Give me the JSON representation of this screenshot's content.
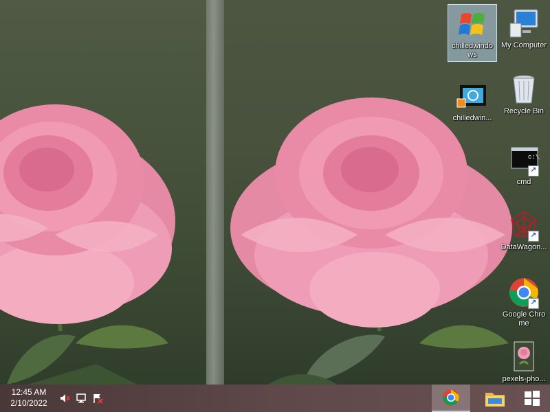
{
  "desktop": {
    "icons": [
      {
        "id": "my-computer",
        "label": "My Computer",
        "icon": "computer-icon"
      },
      {
        "id": "chilledwindows",
        "label": "chilledwindo ws",
        "icon": "windows-logo-icon",
        "selected": true
      },
      {
        "id": "recycle-bin",
        "label": "Recycle Bin",
        "icon": "recycle-bin-icon"
      },
      {
        "id": "chilledwin-video",
        "label": "chilledwin...",
        "icon": "video-file-icon"
      },
      {
        "id": "cmd",
        "label": "cmd",
        "icon": "cmd-icon"
      },
      {
        "id": "datawagon",
        "label": "DataWagon...",
        "icon": "datawagon-icon"
      },
      {
        "id": "google-chrome",
        "label": "Google Chrome",
        "icon": "chrome-icon"
      },
      {
        "id": "pexels-photo",
        "label": "pexels-pho...",
        "icon": "image-file-icon"
      }
    ]
  },
  "taskbar": {
    "clock_time": "12:45 AM",
    "clock_date": "2/10/2022",
    "tray": [
      "flag-alert-icon",
      "network-icon",
      "volume-muted-icon"
    ],
    "buttons": [
      {
        "id": "chrome",
        "icon": "chrome-icon",
        "active": true
      },
      {
        "id": "file-explorer",
        "icon": "folder-icon"
      },
      {
        "id": "start",
        "icon": "windows-start-icon"
      }
    ]
  }
}
